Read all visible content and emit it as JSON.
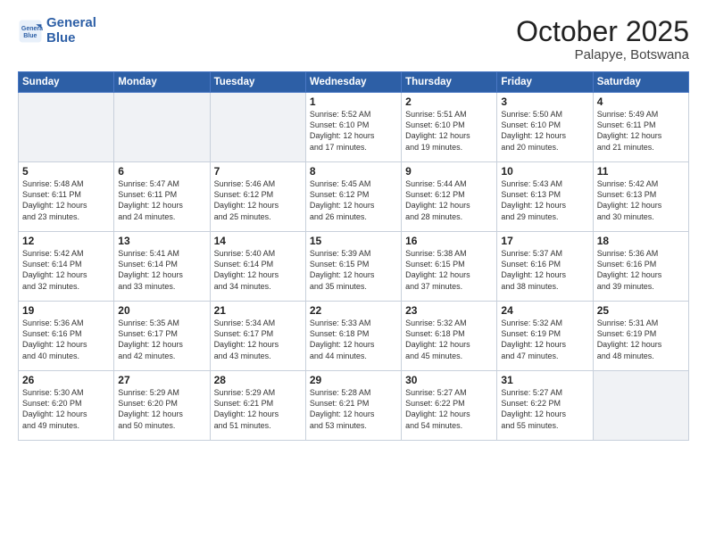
{
  "header": {
    "logo_line1": "General",
    "logo_line2": "Blue",
    "month": "October 2025",
    "location": "Palapye, Botswana"
  },
  "days_of_week": [
    "Sunday",
    "Monday",
    "Tuesday",
    "Wednesday",
    "Thursday",
    "Friday",
    "Saturday"
  ],
  "weeks": [
    [
      {
        "num": "",
        "info": ""
      },
      {
        "num": "",
        "info": ""
      },
      {
        "num": "",
        "info": ""
      },
      {
        "num": "1",
        "info": "Sunrise: 5:52 AM\nSunset: 6:10 PM\nDaylight: 12 hours\nand 17 minutes."
      },
      {
        "num": "2",
        "info": "Sunrise: 5:51 AM\nSunset: 6:10 PM\nDaylight: 12 hours\nand 19 minutes."
      },
      {
        "num": "3",
        "info": "Sunrise: 5:50 AM\nSunset: 6:10 PM\nDaylight: 12 hours\nand 20 minutes."
      },
      {
        "num": "4",
        "info": "Sunrise: 5:49 AM\nSunset: 6:11 PM\nDaylight: 12 hours\nand 21 minutes."
      }
    ],
    [
      {
        "num": "5",
        "info": "Sunrise: 5:48 AM\nSunset: 6:11 PM\nDaylight: 12 hours\nand 23 minutes."
      },
      {
        "num": "6",
        "info": "Sunrise: 5:47 AM\nSunset: 6:11 PM\nDaylight: 12 hours\nand 24 minutes."
      },
      {
        "num": "7",
        "info": "Sunrise: 5:46 AM\nSunset: 6:12 PM\nDaylight: 12 hours\nand 25 minutes."
      },
      {
        "num": "8",
        "info": "Sunrise: 5:45 AM\nSunset: 6:12 PM\nDaylight: 12 hours\nand 26 minutes."
      },
      {
        "num": "9",
        "info": "Sunrise: 5:44 AM\nSunset: 6:12 PM\nDaylight: 12 hours\nand 28 minutes."
      },
      {
        "num": "10",
        "info": "Sunrise: 5:43 AM\nSunset: 6:13 PM\nDaylight: 12 hours\nand 29 minutes."
      },
      {
        "num": "11",
        "info": "Sunrise: 5:42 AM\nSunset: 6:13 PM\nDaylight: 12 hours\nand 30 minutes."
      }
    ],
    [
      {
        "num": "12",
        "info": "Sunrise: 5:42 AM\nSunset: 6:14 PM\nDaylight: 12 hours\nand 32 minutes."
      },
      {
        "num": "13",
        "info": "Sunrise: 5:41 AM\nSunset: 6:14 PM\nDaylight: 12 hours\nand 33 minutes."
      },
      {
        "num": "14",
        "info": "Sunrise: 5:40 AM\nSunset: 6:14 PM\nDaylight: 12 hours\nand 34 minutes."
      },
      {
        "num": "15",
        "info": "Sunrise: 5:39 AM\nSunset: 6:15 PM\nDaylight: 12 hours\nand 35 minutes."
      },
      {
        "num": "16",
        "info": "Sunrise: 5:38 AM\nSunset: 6:15 PM\nDaylight: 12 hours\nand 37 minutes."
      },
      {
        "num": "17",
        "info": "Sunrise: 5:37 AM\nSunset: 6:16 PM\nDaylight: 12 hours\nand 38 minutes."
      },
      {
        "num": "18",
        "info": "Sunrise: 5:36 AM\nSunset: 6:16 PM\nDaylight: 12 hours\nand 39 minutes."
      }
    ],
    [
      {
        "num": "19",
        "info": "Sunrise: 5:36 AM\nSunset: 6:16 PM\nDaylight: 12 hours\nand 40 minutes."
      },
      {
        "num": "20",
        "info": "Sunrise: 5:35 AM\nSunset: 6:17 PM\nDaylight: 12 hours\nand 42 minutes."
      },
      {
        "num": "21",
        "info": "Sunrise: 5:34 AM\nSunset: 6:17 PM\nDaylight: 12 hours\nand 43 minutes."
      },
      {
        "num": "22",
        "info": "Sunrise: 5:33 AM\nSunset: 6:18 PM\nDaylight: 12 hours\nand 44 minutes."
      },
      {
        "num": "23",
        "info": "Sunrise: 5:32 AM\nSunset: 6:18 PM\nDaylight: 12 hours\nand 45 minutes."
      },
      {
        "num": "24",
        "info": "Sunrise: 5:32 AM\nSunset: 6:19 PM\nDaylight: 12 hours\nand 47 minutes."
      },
      {
        "num": "25",
        "info": "Sunrise: 5:31 AM\nSunset: 6:19 PM\nDaylight: 12 hours\nand 48 minutes."
      }
    ],
    [
      {
        "num": "26",
        "info": "Sunrise: 5:30 AM\nSunset: 6:20 PM\nDaylight: 12 hours\nand 49 minutes."
      },
      {
        "num": "27",
        "info": "Sunrise: 5:29 AM\nSunset: 6:20 PM\nDaylight: 12 hours\nand 50 minutes."
      },
      {
        "num": "28",
        "info": "Sunrise: 5:29 AM\nSunset: 6:21 PM\nDaylight: 12 hours\nand 51 minutes."
      },
      {
        "num": "29",
        "info": "Sunrise: 5:28 AM\nSunset: 6:21 PM\nDaylight: 12 hours\nand 53 minutes."
      },
      {
        "num": "30",
        "info": "Sunrise: 5:27 AM\nSunset: 6:22 PM\nDaylight: 12 hours\nand 54 minutes."
      },
      {
        "num": "31",
        "info": "Sunrise: 5:27 AM\nSunset: 6:22 PM\nDaylight: 12 hours\nand 55 minutes."
      },
      {
        "num": "",
        "info": ""
      }
    ]
  ]
}
